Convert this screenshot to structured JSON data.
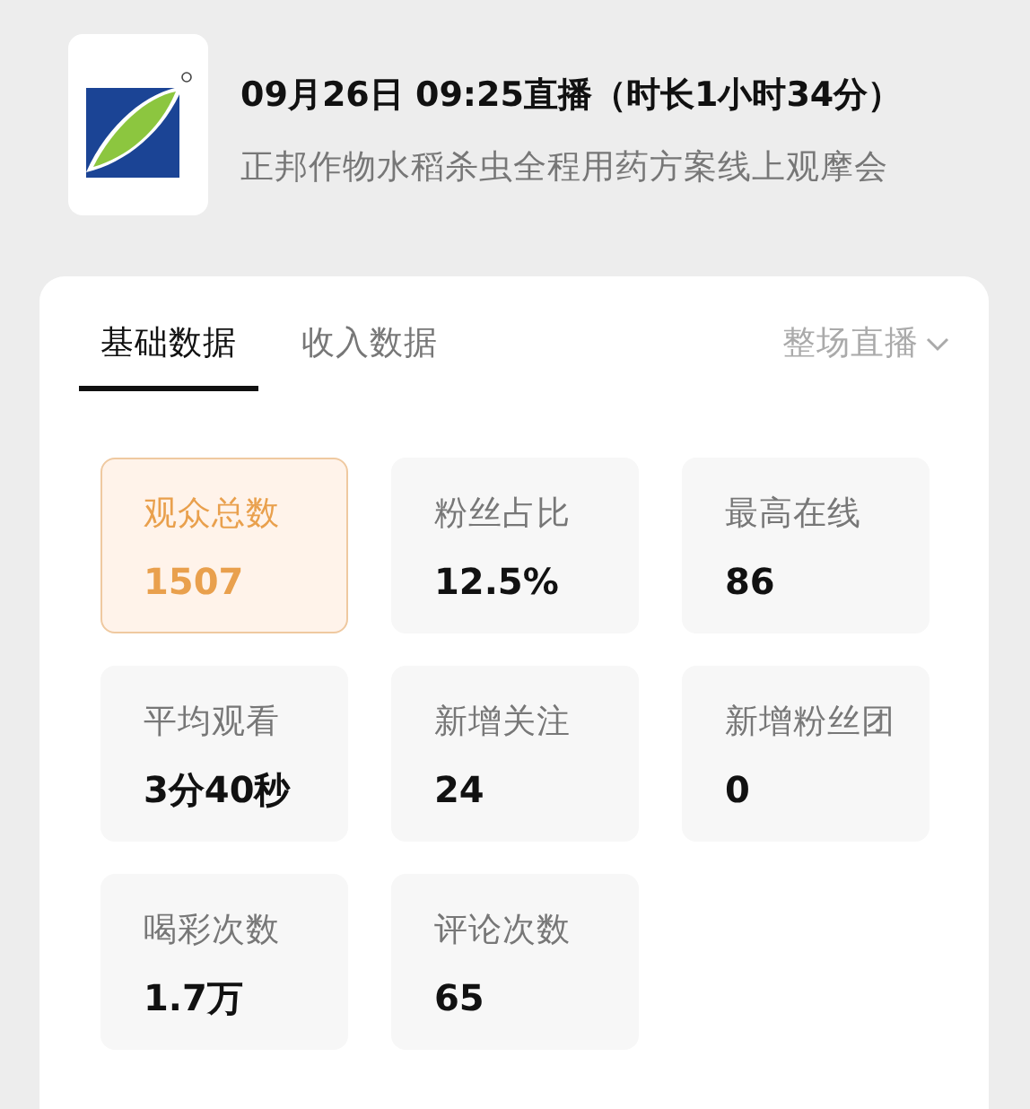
{
  "header": {
    "title": "09月26日 09:25直播（时长1小时34分）",
    "subtitle": "正邦作物水稻杀虫全程用药方案线上观摩会"
  },
  "tabs": [
    {
      "label": "基础数据",
      "selected": true
    },
    {
      "label": "收入数据",
      "selected": false
    }
  ],
  "range_dropdown": {
    "label": "整场直播"
  },
  "metrics": [
    {
      "label": "观众总数",
      "value": "1507",
      "selected": true
    },
    {
      "label": "粉丝占比",
      "value": "12.5%",
      "selected": false
    },
    {
      "label": "最高在线",
      "value": "86",
      "selected": false
    },
    {
      "label": "平均观看",
      "value": "3分40秒",
      "selected": false
    },
    {
      "label": "新增关注",
      "value": "24",
      "selected": false
    },
    {
      "label": "新增粉丝团",
      "value": "0",
      "selected": false
    },
    {
      "label": "喝彩次数",
      "value": "1.7万",
      "selected": false
    },
    {
      "label": "评论次数",
      "value": "65",
      "selected": false
    }
  ]
}
